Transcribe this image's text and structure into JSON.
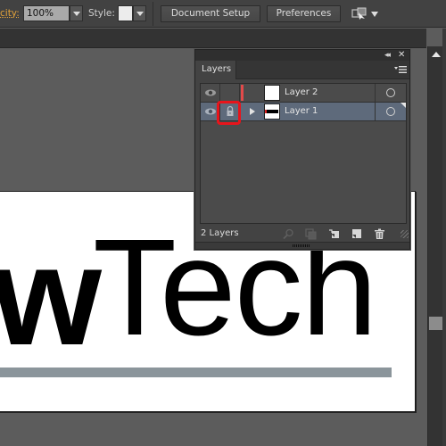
{
  "controlbar": {
    "opacity_label": "city:",
    "opacity_value": "100%",
    "style_label": "Style:",
    "document_setup_label": "Document Setup",
    "preferences_label": "Preferences",
    "style_swatch_color": "#ececec"
  },
  "artboard": {
    "text_bold": "w",
    "text_regular": "Tech",
    "bar_color": "#8b959b"
  },
  "layers_panel": {
    "tab_label": "Layers",
    "collapse_glyph": "◂◂",
    "close_glyph": "✕",
    "layers": [
      {
        "name": "Layer 2",
        "visible": true,
        "locked": false,
        "color": "#e24a4a",
        "expandable": false,
        "selected": false
      },
      {
        "name": "Layer 1",
        "visible": true,
        "locked": true,
        "color": "#e24a4a",
        "expandable": true,
        "selected": true
      }
    ],
    "footer": {
      "count_label": "2 Layers",
      "icons": [
        "locate-object-icon",
        "make-clipping-mask-icon",
        "create-sublayer-icon",
        "new-layer-icon",
        "delete-layer-icon"
      ]
    }
  }
}
